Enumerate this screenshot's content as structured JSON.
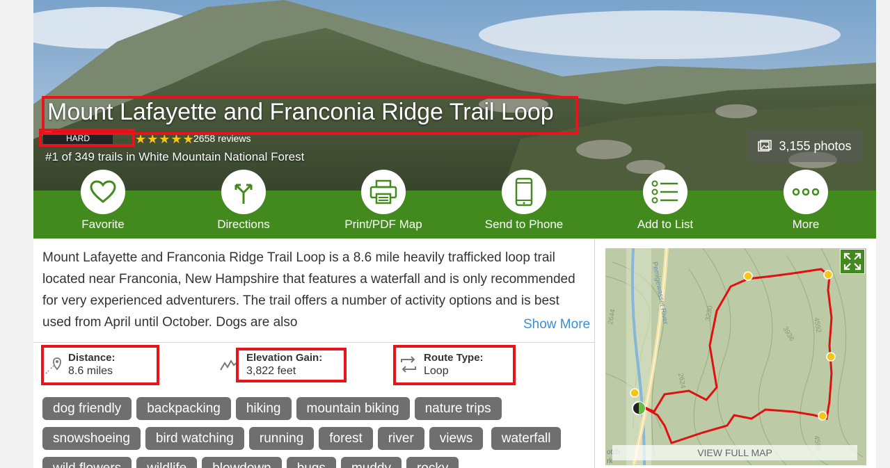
{
  "trail": {
    "title": "Mount Lafayette and Franconia Ridge Trail Loop",
    "difficulty": "HARD",
    "stars": "★★★★★",
    "reviews": "2658 reviews",
    "rank": "#1 of 349 trails in White Mountain National Forest",
    "photos": "3,155 photos"
  },
  "actions": [
    {
      "label": "Favorite",
      "icon": "heart-icon"
    },
    {
      "label": "Directions",
      "icon": "directions-icon"
    },
    {
      "label": "Print/PDF Map",
      "icon": "printer-icon"
    },
    {
      "label": "Send to Phone",
      "icon": "phone-icon"
    },
    {
      "label": "Add to List",
      "icon": "list-icon"
    },
    {
      "label": "More",
      "icon": "more-icon"
    }
  ],
  "description": {
    "text": "Mount Lafayette and Franconia Ridge Trail Loop is a 8.6 mile heavily trafficked loop trail located near Franconia, New Hampshire that features a waterfall and is only recommended for very experienced adventurers. The trail offers a number of activity options and is best used from April until October. Dogs are also",
    "show_more": "Show More"
  },
  "stats": {
    "distance": {
      "label": "Distance:",
      "value": "8.6 miles"
    },
    "elevation": {
      "label": "Elevation Gain:",
      "value": "3,822 feet"
    },
    "route": {
      "label": "Route Type:",
      "value": "Loop"
    }
  },
  "tags": [
    "dog friendly",
    "backpacking",
    "hiking",
    "mountain biking",
    "nature trips",
    "snowshoeing",
    "bird watching",
    "running",
    "forest",
    "river",
    "views",
    "waterfall",
    "wild flowers",
    "wildlife",
    "blowdown",
    "bugs",
    "muddy",
    "rocky"
  ],
  "map": {
    "view_full": "VIEW FULL MAP",
    "labels": [
      "2644",
      "3230",
      "3936",
      "4592",
      "2624",
      "4592",
      "Pemigewasset River",
      "otch",
      "rk"
    ]
  },
  "colors": {
    "accent": "#428a1e",
    "highlight": "#e8141c",
    "tag_bg": "#6f6f6f",
    "link": "#3a8ed6"
  }
}
